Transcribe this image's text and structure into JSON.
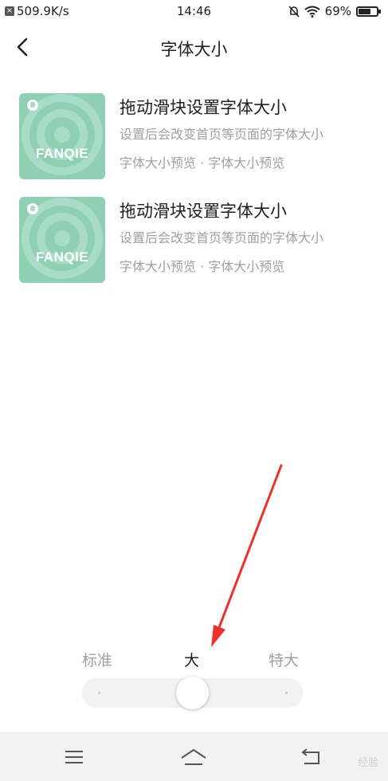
{
  "status_bar": {
    "net_speed": "509.9K/s",
    "time": "14:46",
    "battery": "69%",
    "battery_level": 0.69
  },
  "header": {
    "title": "字体大小",
    "back_icon": "chevron-left-icon"
  },
  "preview_items": [
    {
      "brand": "FANQIE",
      "title": "拖动滑块设置字体大小",
      "description": "设置后会改变首页等页面的字体大小",
      "meta": "字体大小预览 · 字体大小预览"
    },
    {
      "brand": "FANQIE",
      "title": "拖动滑块设置字体大小",
      "description": "设置后会改变首页等页面的字体大小",
      "meta": "字体大小预览 · 字体大小预览"
    }
  ],
  "font_slider": {
    "options": [
      "标准",
      "大",
      "特大"
    ],
    "selected": "大",
    "selected_index": 1
  },
  "nav_bar": {
    "menu_icon": "menu-icon",
    "home_icon": "home-icon",
    "back_icon": "back-icon",
    "watermark": "经验"
  },
  "colors": {
    "thumb_bg": "#8fd0b4",
    "arrow": "#f0302a",
    "muted_text": "#a0a0a0",
    "selected_text": "#1f1f1f"
  }
}
